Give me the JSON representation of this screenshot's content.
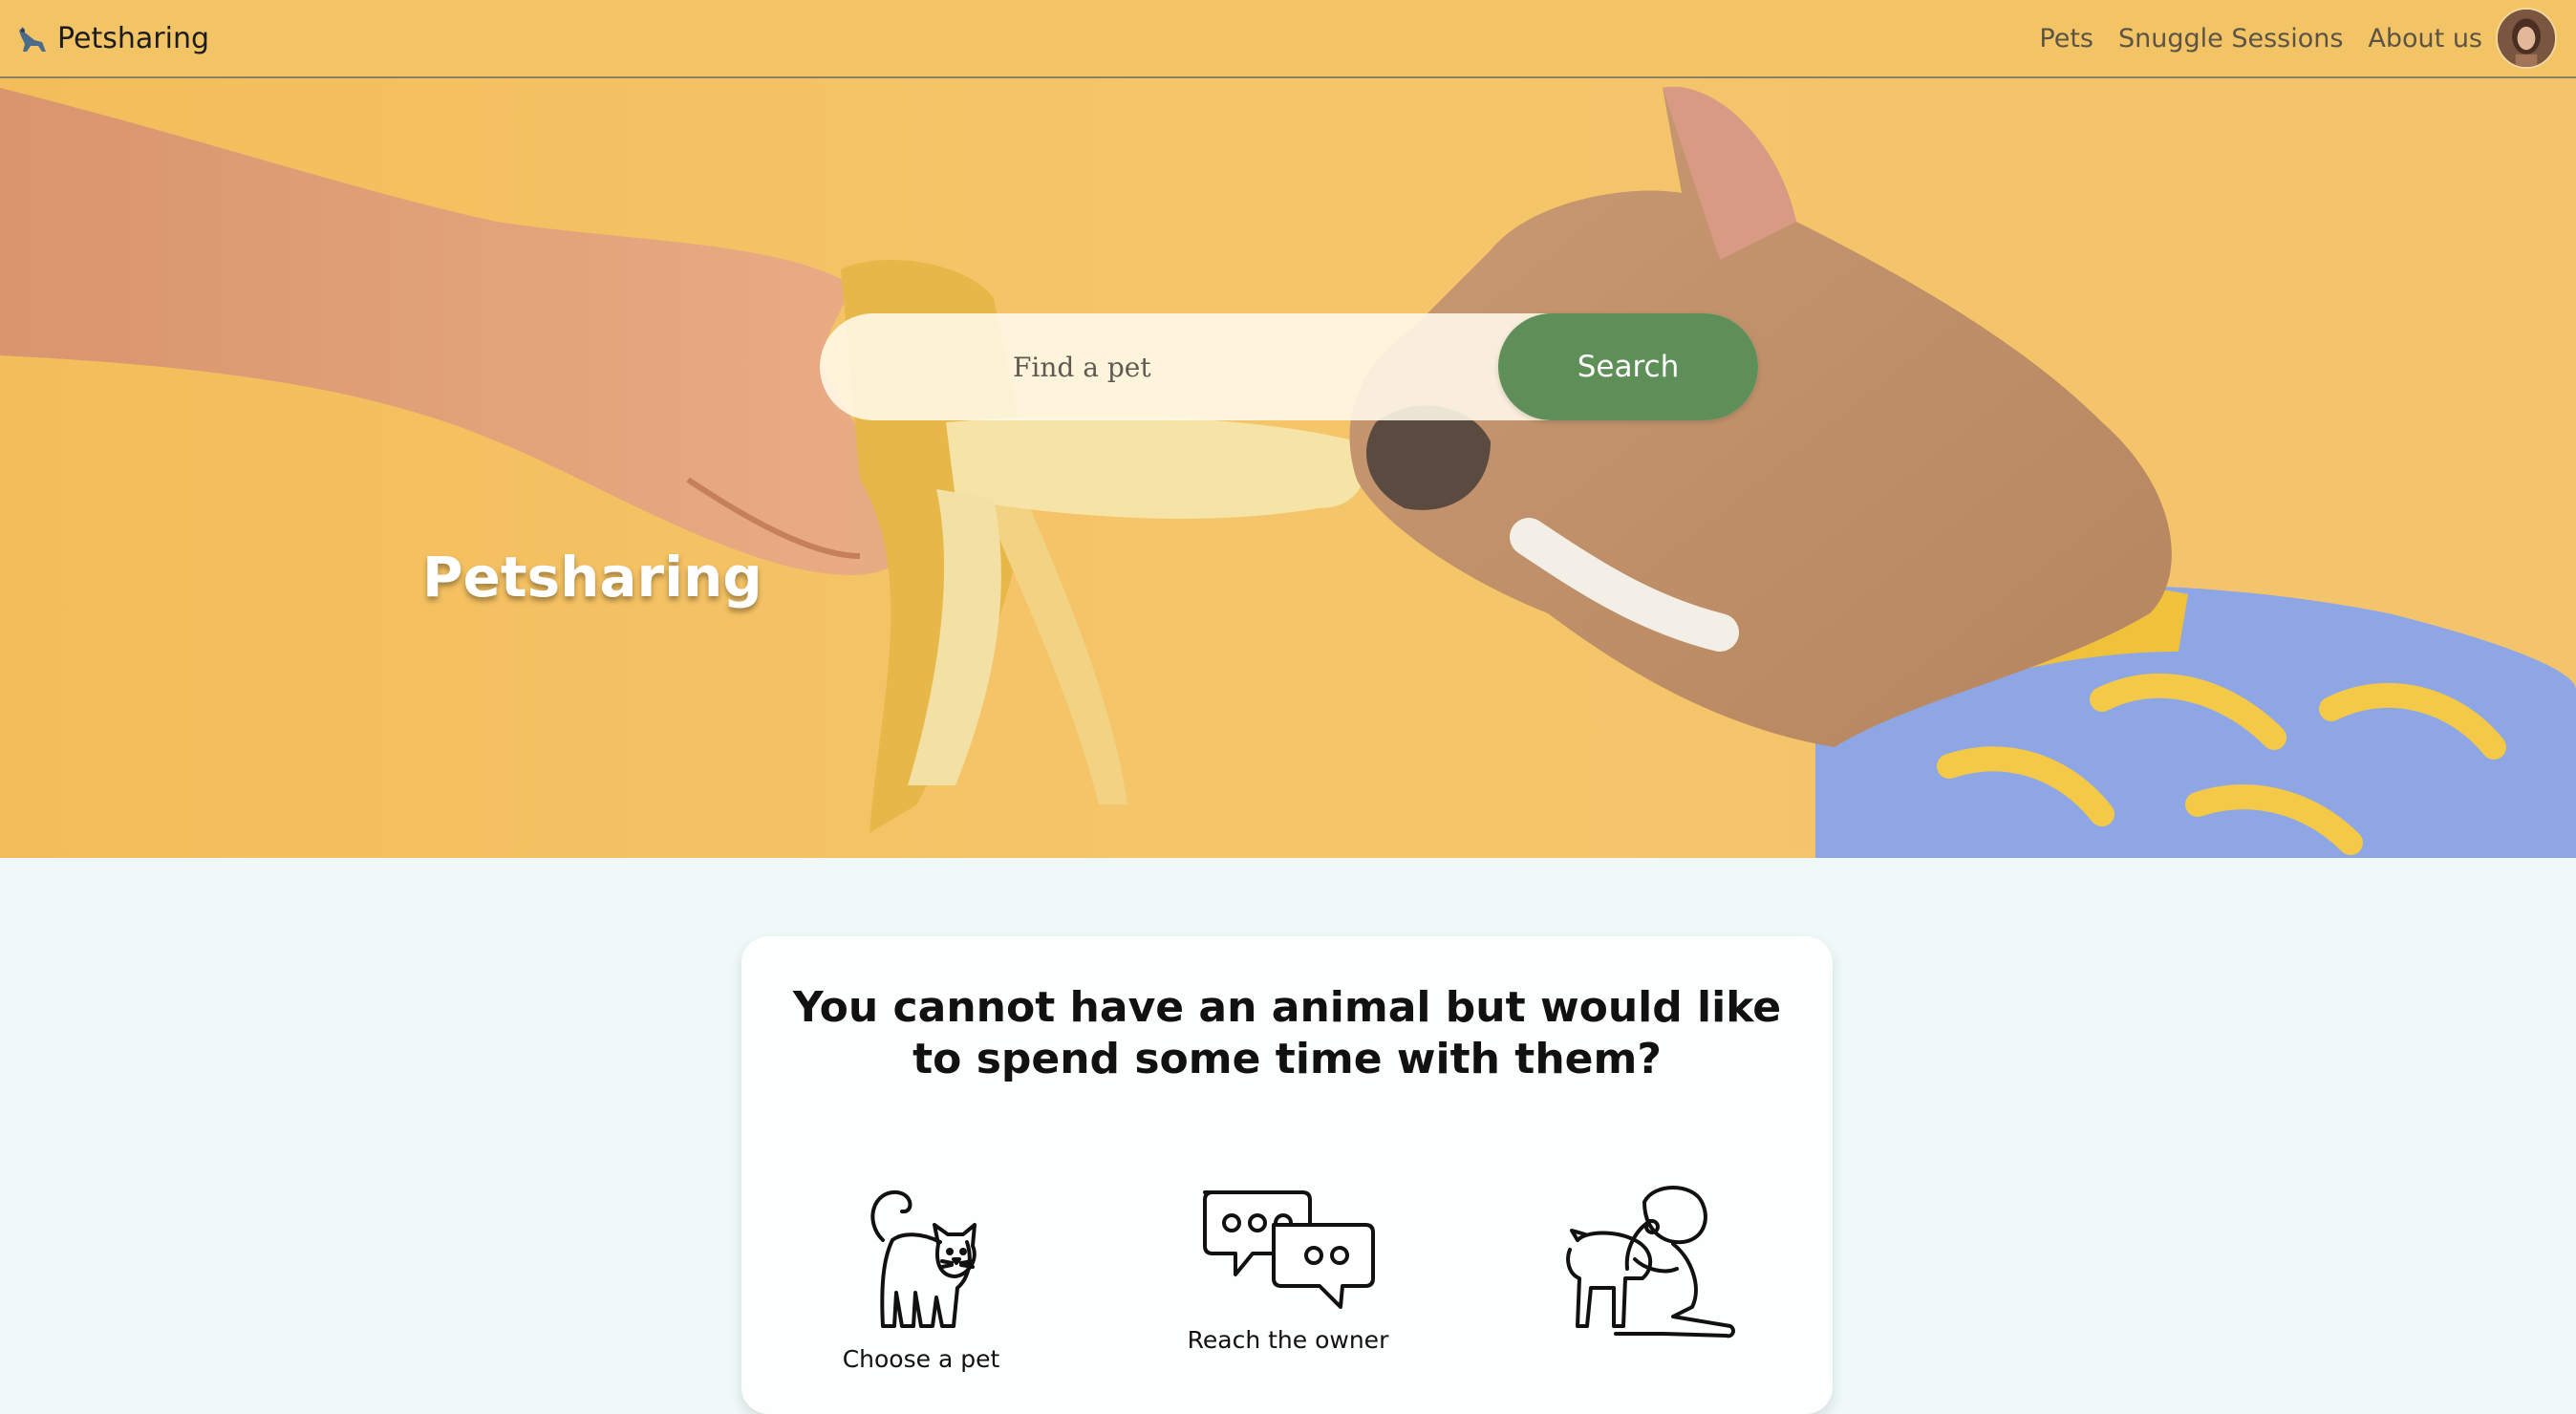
{
  "navbar": {
    "brand": "Petsharing",
    "links": [
      "Pets",
      "Snuggle Sessions",
      "About us"
    ],
    "avatar_alt": "user avatar"
  },
  "hero": {
    "search_placeholder": "Find a pet",
    "search_button": "Search",
    "title": "Petsharing"
  },
  "info": {
    "heading": "You cannot have an animal but would like to spend some time with them?",
    "steps": [
      {
        "icon": "cat-icon",
        "label": "Choose a pet"
      },
      {
        "icon": "chat-bubbles-icon",
        "label": "Reach the owner"
      },
      {
        "icon": "cuddle-dog-icon",
        "label": ""
      }
    ]
  },
  "colors": {
    "navbar_bg": "#f3c465",
    "hero_bg": "#f4c46c",
    "search_button": "#5f8f58",
    "page_bg": "#effaf8"
  }
}
